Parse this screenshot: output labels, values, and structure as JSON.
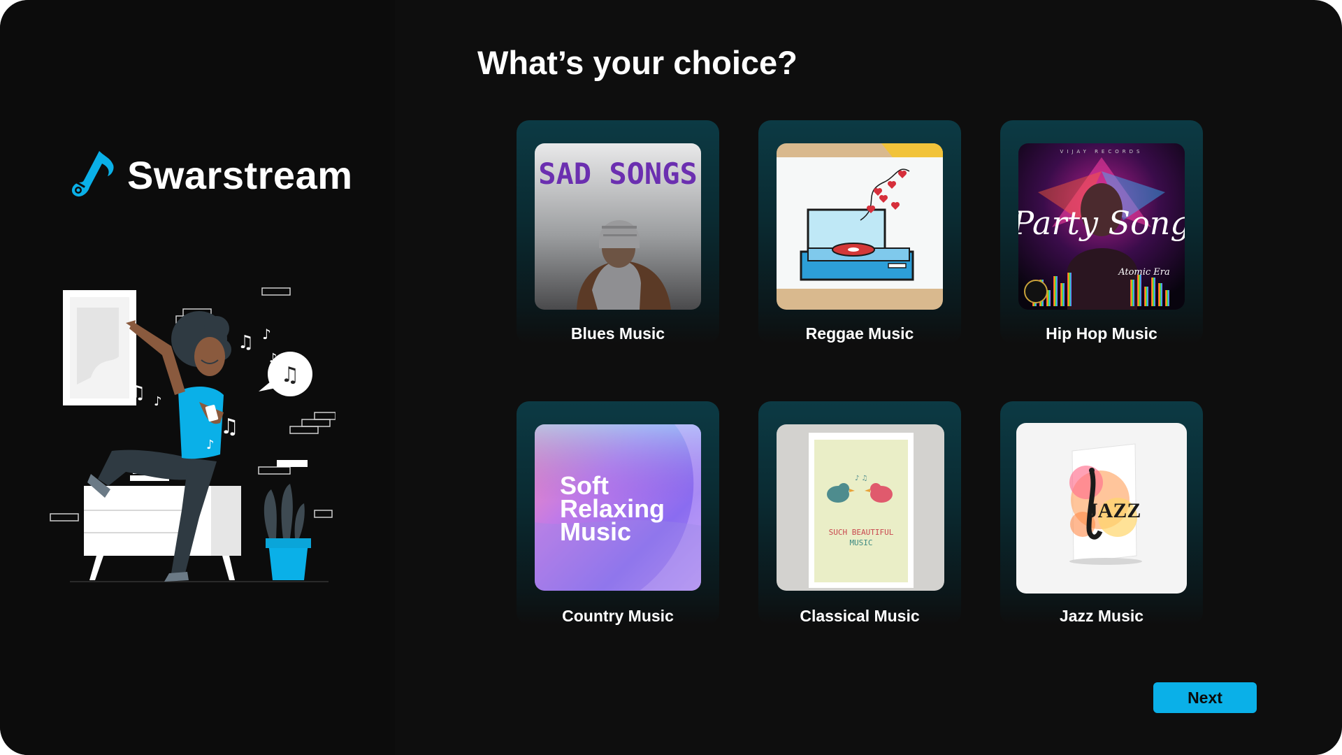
{
  "brand": {
    "name": "Swarstream",
    "logo_icon": "guitar-note-icon",
    "accent": "#0ab0e8"
  },
  "page": {
    "title": "What’s your choice?"
  },
  "genres": [
    {
      "label": "Blues Music",
      "art_text": "SAD SONGS",
      "art": "hooded-person-cover"
    },
    {
      "label": "Reggae Music",
      "art": "record-player-hearts-card"
    },
    {
      "label": "Hip Hop Music",
      "art_text": "Party Song",
      "art_subtext": "Atomic Era",
      "art_top": "VIJAY RECORDS",
      "art": "neon-party-cover"
    },
    {
      "label": "Country Music",
      "art_text_lines": [
        "Soft",
        "Relaxing",
        "Music"
      ],
      "art": "pastel-gradient-cover"
    },
    {
      "label": "Classical Music",
      "art_text_lines": [
        "SUCH BEAUTIFUL",
        "MUSIC"
      ],
      "art": "birds-greeting-card"
    },
    {
      "label": "Jazz Music",
      "art_text": "JAZZ",
      "art": "saxophone-splash-card"
    }
  ],
  "actions": {
    "next_label": "Next"
  },
  "colors": {
    "background": "#0e0e0e",
    "card_top": "#0c3a44",
    "button": "#0ab0e8",
    "text": "#ffffff"
  }
}
